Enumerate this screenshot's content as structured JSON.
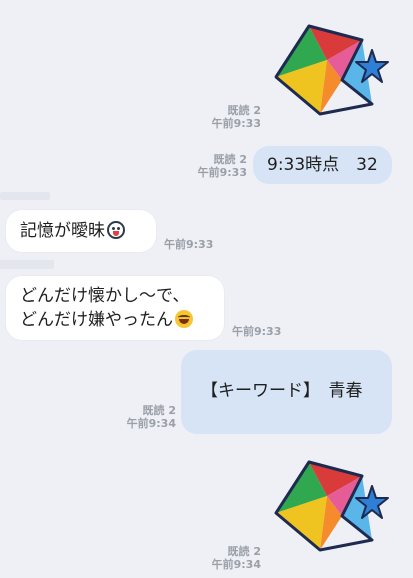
{
  "colors": {
    "background": "#eef0f5",
    "incoming_bubble": "#ffffff",
    "outgoing_bubble": "#d7e4f5",
    "meta_text": "#9a9fa8"
  },
  "messages": [
    {
      "type": "sticker",
      "direction": "out",
      "sticker": "colorful-star-icon",
      "read": "既読 2",
      "time": "午前9:33"
    },
    {
      "type": "text",
      "direction": "out",
      "text": "9:33時点　32",
      "read": "既読 2",
      "time": "午前9:33"
    },
    {
      "type": "text",
      "direction": "in",
      "text": "記憶が曖昧",
      "emoji": "shocked-face-icon",
      "time": "午前9:33"
    },
    {
      "type": "text",
      "direction": "in",
      "line1": "どんだけ懐かし〜で、",
      "line2": "どんだけ嫌やったん",
      "emoji": "laughing-face-icon",
      "time": "午前9:33"
    },
    {
      "type": "text",
      "direction": "out",
      "text": "【キーワード】　青春",
      "read": "既読 2",
      "time": "午前9:34"
    },
    {
      "type": "sticker",
      "direction": "out",
      "sticker": "colorful-star-icon",
      "read": "既読 2",
      "time": "午前9:34"
    }
  ]
}
